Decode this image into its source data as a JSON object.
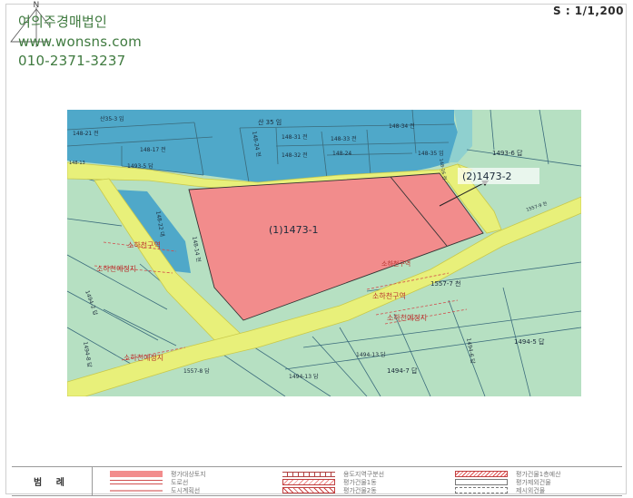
{
  "header": {
    "watermark_lines": [
      "여의주경매법인",
      "www.wonsns.com",
      "010-2371-3237"
    ],
    "compass_label": "N",
    "scale": "S : 1/1,200"
  },
  "map": {
    "main_parcel_label": "(1)1473-1",
    "callout_label": "(2)1473-2",
    "parcels": {
      "p_1493_6": "1493-6 답",
      "p_1557_7": "1557-7 천",
      "p_1494_5": "1494-5 답",
      "p_1494_7": "1494-7 답",
      "p_1494_13": "1494-13 답",
      "p_1557_8": "1557-8 답",
      "p_1494_8": "1494-8 답",
      "p_1494_2": "1494-2 답",
      "p_1493_5": "1493-5 답",
      "p_148_17": "148-17 전",
      "p_148_31": "148-31 전",
      "p_148_33": "148-33 전",
      "p_148_32": "148-32 전",
      "p_148_34": "148-34 전",
      "p_148_35": "148-35 임",
      "p_148_24": "148-24",
      "p_148_21": "148-21 전",
      "p_new35": "산 35 임",
      "p_topleft": "산35-3 임",
      "p_slope": "148-24 전",
      "p_slope2": "148-13",
      "p_148_14": "148-14 전",
      "p_small": "148-22 대",
      "p_right_vert": "1494-6 답",
      "p_road_right": "1557-9 천",
      "p_148_16": "148-16 전"
    },
    "zone_labels": {
      "z_left1": "소하천구역",
      "z_left2": "소하천예정지",
      "z_center": "소하천구역",
      "z_bottom": "소하천예정지",
      "z_line": "소하천구역",
      "z_btm_left": "소하천예정지"
    }
  },
  "legend": {
    "title": "범 례",
    "items": [
      "평가대상토지",
      "도로선",
      "도시계획선",
      "용도지역구분선",
      "평가건물1동",
      "평가건물2동",
      "평가건물1층예산",
      "평가제외건물",
      "제시외건물"
    ]
  }
}
